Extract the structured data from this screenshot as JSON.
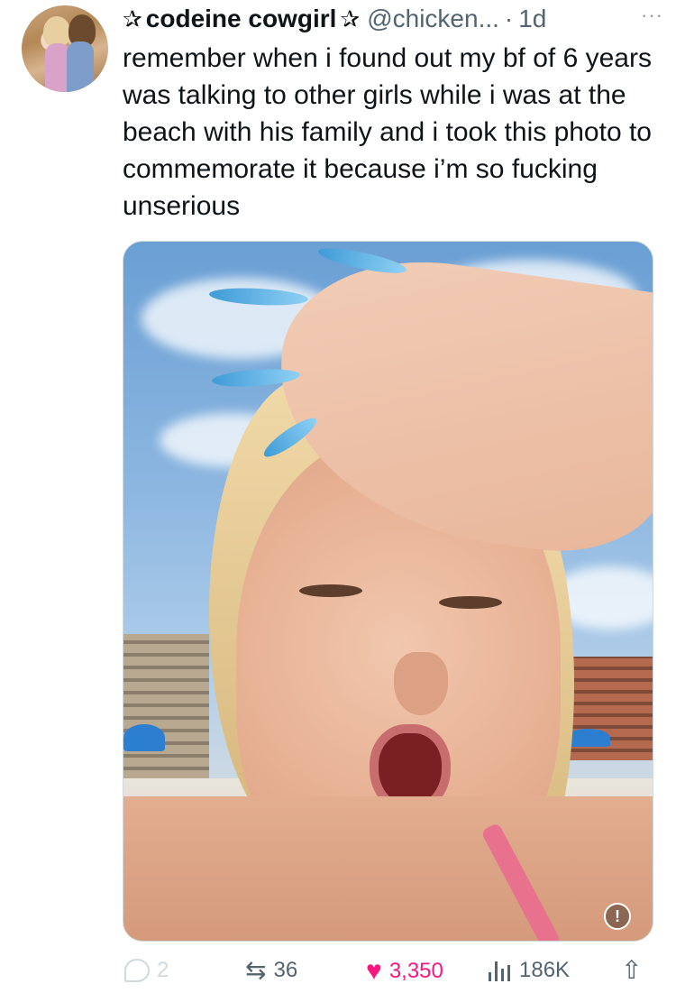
{
  "header": {
    "star_left": "✰",
    "display_name": "codeine cowgirl",
    "star_right": "✰",
    "handle": "@chicken...",
    "separator": "·",
    "time": "1d",
    "more": "···"
  },
  "tweet": {
    "text": "remember when i found out my bf of 6 years was talking to other girls while i was at the beach with his family and i took this photo to commemorate it because i’m so fucking unserious"
  },
  "media": {
    "alert_glyph": "!"
  },
  "actions": {
    "replies": "2",
    "retweets": "36",
    "likes": "3,350",
    "views": "186K"
  },
  "icons": {
    "reply": "reply-icon",
    "retweet": "retweet-icon",
    "like": "heart-icon",
    "views": "bar-chart-icon",
    "share": "share-icon"
  },
  "colors": {
    "like": "#f91880",
    "secondary_text": "#536471",
    "primary_text": "#0f1419"
  }
}
